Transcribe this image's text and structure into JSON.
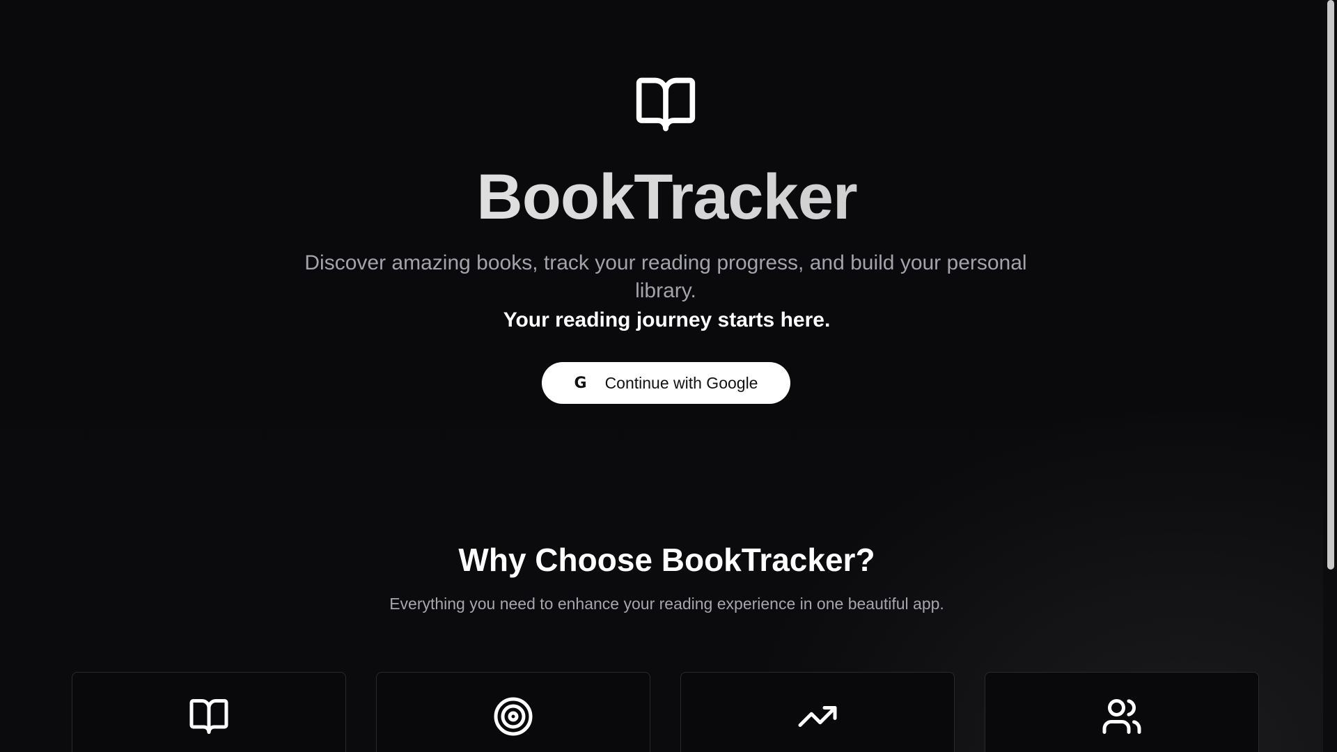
{
  "app": {
    "title": "BookTracker",
    "subtitle": "Discover amazing books, track your reading progress, and build your personal library.",
    "tagline": "Your reading journey starts here."
  },
  "auth": {
    "google_button_label": "Continue with Google",
    "google_icon": "google-g-icon"
  },
  "features_section": {
    "title": "Why Choose BookTracker?",
    "subtitle": "Everything you need to enhance your reading experience in one beautiful app.",
    "cards": [
      {
        "icon": "book-open-icon"
      },
      {
        "icon": "target-icon"
      },
      {
        "icon": "trending-up-icon"
      },
      {
        "icon": "users-icon"
      }
    ]
  },
  "colors": {
    "background": "#0a0a0c",
    "text_primary": "#ffffff",
    "text_muted": "#a3a3ab",
    "button_bg": "#ffffff",
    "card_border": "#2a2a2e"
  }
}
